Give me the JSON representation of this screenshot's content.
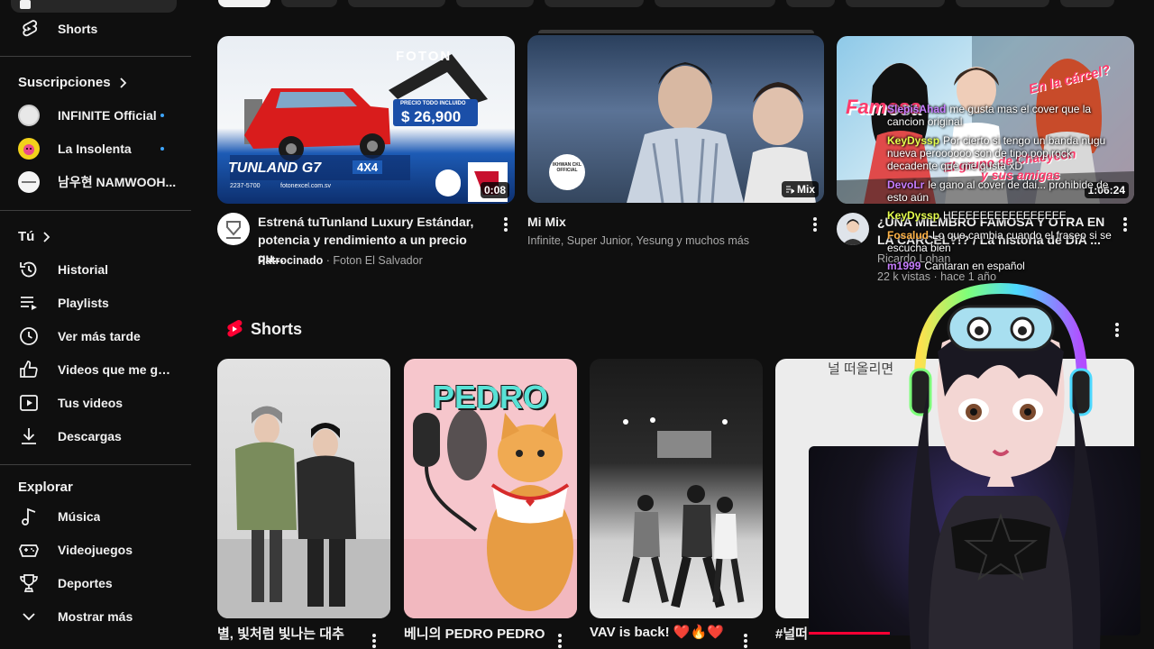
{
  "sidebar": {
    "shorts": "Shorts",
    "subs_header": "Suscripciones",
    "subs": [
      {
        "label": "INFINITE Official",
        "icon": "channel-avatar-icon"
      },
      {
        "label": "La Insolenta",
        "icon": "channel-avatar-icon"
      },
      {
        "label": "남우현 NAMWOOH...",
        "icon": "channel-avatar-icon"
      }
    ],
    "you_header": "Tú",
    "you_items": [
      {
        "label": "Historial",
        "icon": "history-icon"
      },
      {
        "label": "Playlists",
        "icon": "playlists-icon"
      },
      {
        "label": "Ver más tarde",
        "icon": "watch-later-icon"
      },
      {
        "label": "Videos que me gus...",
        "icon": "like-icon"
      },
      {
        "label": "Tus videos",
        "icon": "your-videos-icon"
      },
      {
        "label": "Descargas",
        "icon": "download-icon"
      }
    ],
    "explore_header": "Explorar",
    "explore_items": [
      {
        "label": "Música",
        "icon": "music-icon"
      },
      {
        "label": "Videojuegos",
        "icon": "gaming-icon"
      },
      {
        "label": "Deportes",
        "icon": "trophy-icon"
      },
      {
        "label": "Mostrar más",
        "icon": "chevron-down-icon"
      }
    ]
  },
  "videos": [
    {
      "thumb_brand": "FOTON",
      "thumb_price_label": "PRECIO TODO INCLUIDO",
      "thumb_price": "$ 26,900",
      "thumb_model": "TUNLAND G7",
      "thumb_model_badge": "4X4",
      "thumb_phone": "2237-5700",
      "thumb_site": "fotonexcel.com.sv",
      "duration": "0:08",
      "title_line1": "Estrená tuTunland Luxury Estándar,",
      "title_line2": "potencia y rendimiento a un precio qu...",
      "sponsored": "Patrocinado",
      "channel": "Foton El Salvador"
    },
    {
      "badge": "Mix",
      "watermark": "IKHWAN CKL OFFICIAL",
      "title": "Mi Mix",
      "meta": "Infinite, Super Junior, Yesung y muchos más"
    },
    {
      "overlay1": "Famosa",
      "overlay2": "En la cárcel?",
      "overlay3": "El grupo de Chaeyeon",
      "overlay4": "y sus amigas",
      "duration": "1:06:24",
      "title_line1": "¿UNA MIEMBRO FAMOSA Y OTRA EN",
      "title_line2": "LA CÁRCEL?!? / La historia de DIA ...",
      "channel": "Ricardo Lohan",
      "meta": "22 k vistas · hace 1 año"
    }
  ],
  "chat": [
    {
      "user": "SlepisAhad",
      "text": "me gusta mas el cover que la cancion original",
      "color": "#c77dff"
    },
    {
      "user": "KeyDyssp",
      "text": "Por cierto si tengo un banda nugu nueva peroooooo son de tipo pop rock decadente que me gusta xD",
      "color": "#e6ff4d"
    },
    {
      "user": "DevoLr",
      "text": "le gano al cover de dai... prohibide de esto aún",
      "color": "#c77dff"
    },
    {
      "user": "KeyDyssp",
      "text": "HEEEEEEEEEEEEEEEE",
      "color": "#e6ff4d"
    },
    {
      "user": "Fosalud",
      "text": "Lo que cambia cuando el fraseo si se escucha bien",
      "color": "#ffb347"
    },
    {
      "user": "m1999",
      "text": "Cantaran en español",
      "color": "#c77dff"
    }
  ],
  "shorts": {
    "header": "Shorts",
    "items": [
      {
        "title": "별, 빛처럼 빛나는 대추"
      },
      {
        "title": "베니의 PEDRO PEDRO",
        "overlay": "PEDRO"
      },
      {
        "title": "VAV is back! ❤️🔥❤️"
      },
      {
        "title": "#널떠",
        "overlay": "널 떠올리면"
      }
    ]
  }
}
